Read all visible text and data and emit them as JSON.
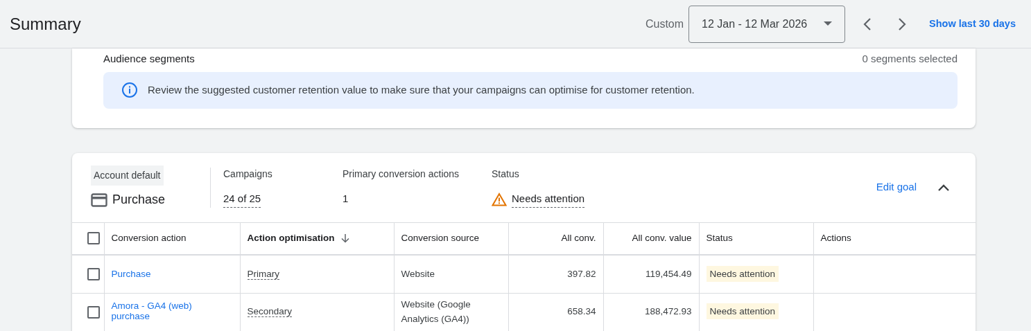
{
  "header": {
    "title": "Summary",
    "range_label": "Custom",
    "date_range": "12 Jan - 12 Mar 2026",
    "show_last": "Show last 30 days"
  },
  "segments_card": {
    "label": "Audience segments",
    "count": "0 segments selected",
    "notice": "Review the suggested customer retention value to make sure that your campaigns can optimise for customer retention."
  },
  "goal": {
    "badge": "Account default",
    "name": "Purchase",
    "stats": [
      {
        "label": "Campaigns",
        "value": "24 of 25",
        "kind": "link"
      },
      {
        "label": "Primary conversion actions",
        "value": "1",
        "kind": "plain"
      },
      {
        "label": "Status",
        "value": "Needs attention",
        "kind": "warning"
      }
    ],
    "edit": "Edit goal",
    "expanded": true
  },
  "table": {
    "select_all": {
      "checked": false
    },
    "columns": [
      {
        "label": "Conversion action",
        "kind": "text",
        "sorted": false
      },
      {
        "label": "Action optimisation",
        "kind": "text",
        "sorted": true
      },
      {
        "label": "Conversion source",
        "kind": "text",
        "sorted": false
      },
      {
        "label": "All conv.",
        "kind": "number",
        "sorted": false
      },
      {
        "label": "All conv. value",
        "kind": "number",
        "sorted": false
      },
      {
        "label": "Status",
        "kind": "text",
        "sorted": false
      },
      {
        "label": "Actions",
        "kind": "text",
        "sorted": false
      }
    ],
    "rows": [
      {
        "checked": false,
        "action": "Purchase",
        "optimisation": "Primary",
        "source": "Website",
        "all_conv": "397.82",
        "all_conv_value": "119,454.49",
        "status": "Needs attention"
      },
      {
        "checked": false,
        "action": "Amora - GA4 (web) purchase",
        "optimisation": "Secondary",
        "source": "Website (Google Analytics (GA4))",
        "all_conv": "658.34",
        "all_conv_value": "188,472.93",
        "status": "Needs attention"
      }
    ]
  }
}
